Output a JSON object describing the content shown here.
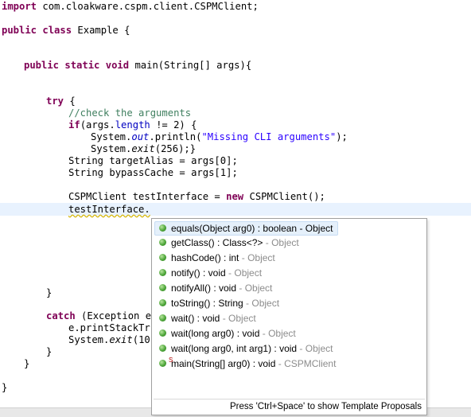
{
  "editor": {
    "lines": {
      "l1": {
        "kw": "import",
        "rest": " com.cloakware.cspm.client.CSPMClient;"
      },
      "l2": {
        "kw1": "public",
        "kw2": "class",
        "rest": " Example {"
      },
      "l3": {
        "kw1": "public",
        "kw2": "static",
        "kw3": "void",
        "rest": " main(String[] args){"
      },
      "l4": {
        "kw": "try",
        "rest": " {"
      },
      "l5": {
        "comment": "//check the arguments"
      },
      "l6": {
        "kw": "if",
        "a": "(args.",
        "field": "length",
        "b": " != 2) {"
      },
      "l7": {
        "a": "System.",
        "field": "out",
        "b": ".println(",
        "str": "\"Missing CLI arguments\"",
        "c": ");"
      },
      "l8": {
        "a": "System.",
        "method": "exit",
        "b": "(256);}"
      },
      "l9": {
        "text": "String targetAlias = args[0];"
      },
      "l10": {
        "text": "String bypassCache = args[1];"
      },
      "l11": {
        "a": "CSPMClient testInterface = ",
        "kw": "new",
        "b": " CSPMClient();"
      },
      "l12": {
        "text": "testInterface."
      },
      "l13": {
        "text": "}"
      },
      "l14": {
        "kw": "catch",
        "rest": " (Exception e"
      },
      "l15": {
        "text": "e.printStackTr"
      },
      "l16": {
        "a": "System.",
        "method": "exit",
        "b": "(10"
      },
      "l17": {
        "text": "}"
      },
      "l18": {
        "text": "}"
      },
      "l19": {
        "text": "}"
      }
    }
  },
  "content_assist": {
    "proposals": [
      {
        "signature": "equals(Object arg0) : boolean",
        "separator": " - ",
        "owner": "Object"
      },
      {
        "signature": "getClass() : Class<?>",
        "separator": " - ",
        "owner": "Object"
      },
      {
        "signature": "hashCode() : int",
        "separator": " - ",
        "owner": "Object"
      },
      {
        "signature": "notify() : void",
        "separator": " - ",
        "owner": "Object"
      },
      {
        "signature": "notifyAll() : void",
        "separator": " - ",
        "owner": "Object"
      },
      {
        "signature": "toString() : String",
        "separator": " - ",
        "owner": "Object"
      },
      {
        "signature": "wait() : void",
        "separator": " - ",
        "owner": "Object"
      },
      {
        "signature": "wait(long arg0) : void",
        "separator": " - ",
        "owner": "Object"
      },
      {
        "signature": "wait(long arg0, int arg1) : void",
        "separator": " - ",
        "owner": "Object"
      },
      {
        "signature": "main(String[] arg0) : void",
        "separator": " - ",
        "owner": "CSPMClient",
        "marker": "S"
      }
    ],
    "footer": "Press 'Ctrl+Space' to show Template Proposals"
  },
  "icons": {
    "method": "public-method-icon",
    "static_method": "public-static-method-icon"
  },
  "colors": {
    "keyword": "#7f0055",
    "comment": "#3f7f5f",
    "string": "#2a00ff",
    "field": "#0000c0",
    "current_line": "#e8f2fe",
    "proposal_owner": "#8c8c8c",
    "selection": "#e5f0fb"
  }
}
